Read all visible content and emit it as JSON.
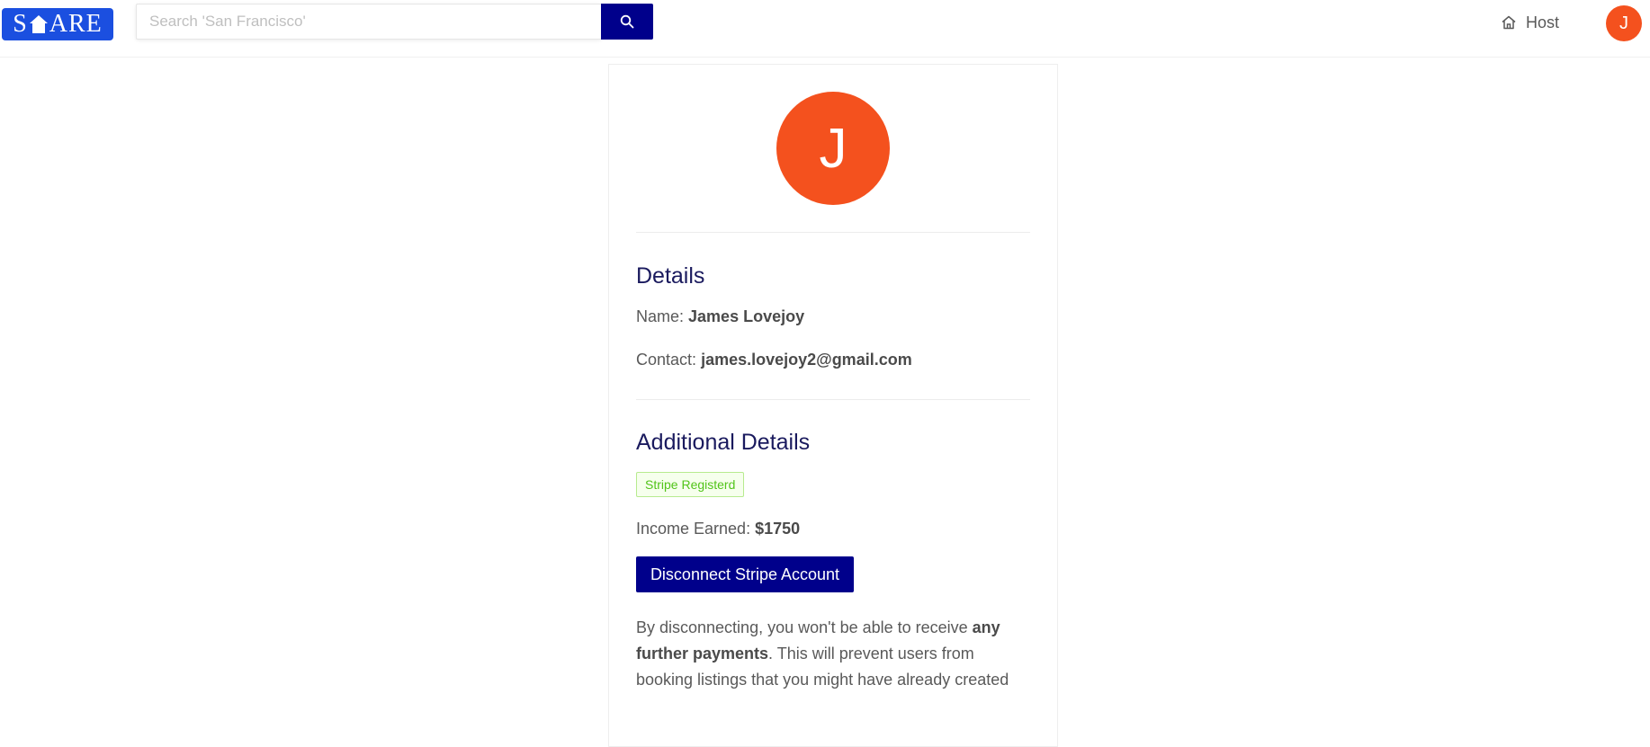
{
  "header": {
    "logo_text_before": "S",
    "logo_text_after": "ARE",
    "search_placeholder": "Search 'San Francisco'",
    "search_icon": "search-icon",
    "host_label": "Host",
    "host_icon": "home-icon",
    "avatar_initial": "J",
    "avatar_color": "#f4511e",
    "accent_color": "#00008b",
    "logo_color": "#1b4fe0"
  },
  "profile": {
    "avatar_initial": "J",
    "details_title": "Details",
    "name_label": "Name:",
    "name_value": "James Lovejoy",
    "contact_label": "Contact:",
    "contact_value": "james.lovejoy2@gmail.com",
    "additional_title": "Additional Details",
    "stripe_tag": "Stripe Registerd",
    "income_label": "Income Earned:",
    "income_value": "$1750",
    "disconnect_button": "Disconnect Stripe Account",
    "warning_prefix": "By disconnecting, you won't be able to receive ",
    "warning_bold": "any further payments",
    "warning_suffix": ". This will prevent users from booking listings that you might have already created"
  }
}
